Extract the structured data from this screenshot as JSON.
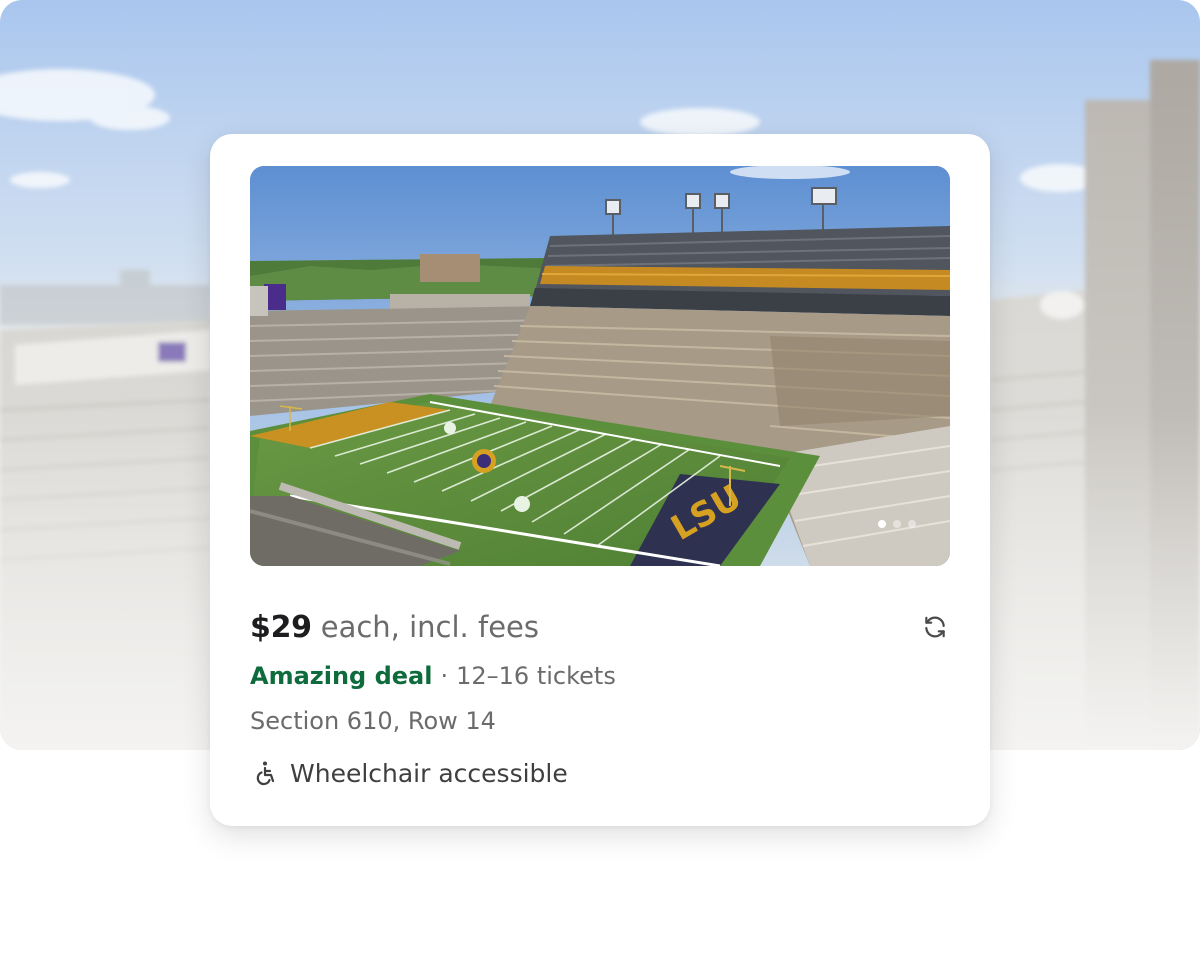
{
  "listing": {
    "price": "$29",
    "price_suffix": "each, incl. fees",
    "deal_label": "Amazing deal",
    "separator": "·",
    "ticket_count": "12–16 tickets",
    "seat_location": "Section 610, Row 14",
    "accessibility_label": "Wheelchair accessible",
    "image_carousel": {
      "slide_count": 3,
      "active_index": 0
    },
    "icons": {
      "refresh": "refresh-icon",
      "accessibility": "wheelchair-icon"
    }
  },
  "colors": {
    "deal_green": "#0d6b3c",
    "primary_text": "#1d1d1f",
    "secondary_text": "#6b6b6b",
    "field_green": "#5a8a3a",
    "lsu_gold": "#d6a021",
    "lsu_purple": "#3b2d78"
  }
}
